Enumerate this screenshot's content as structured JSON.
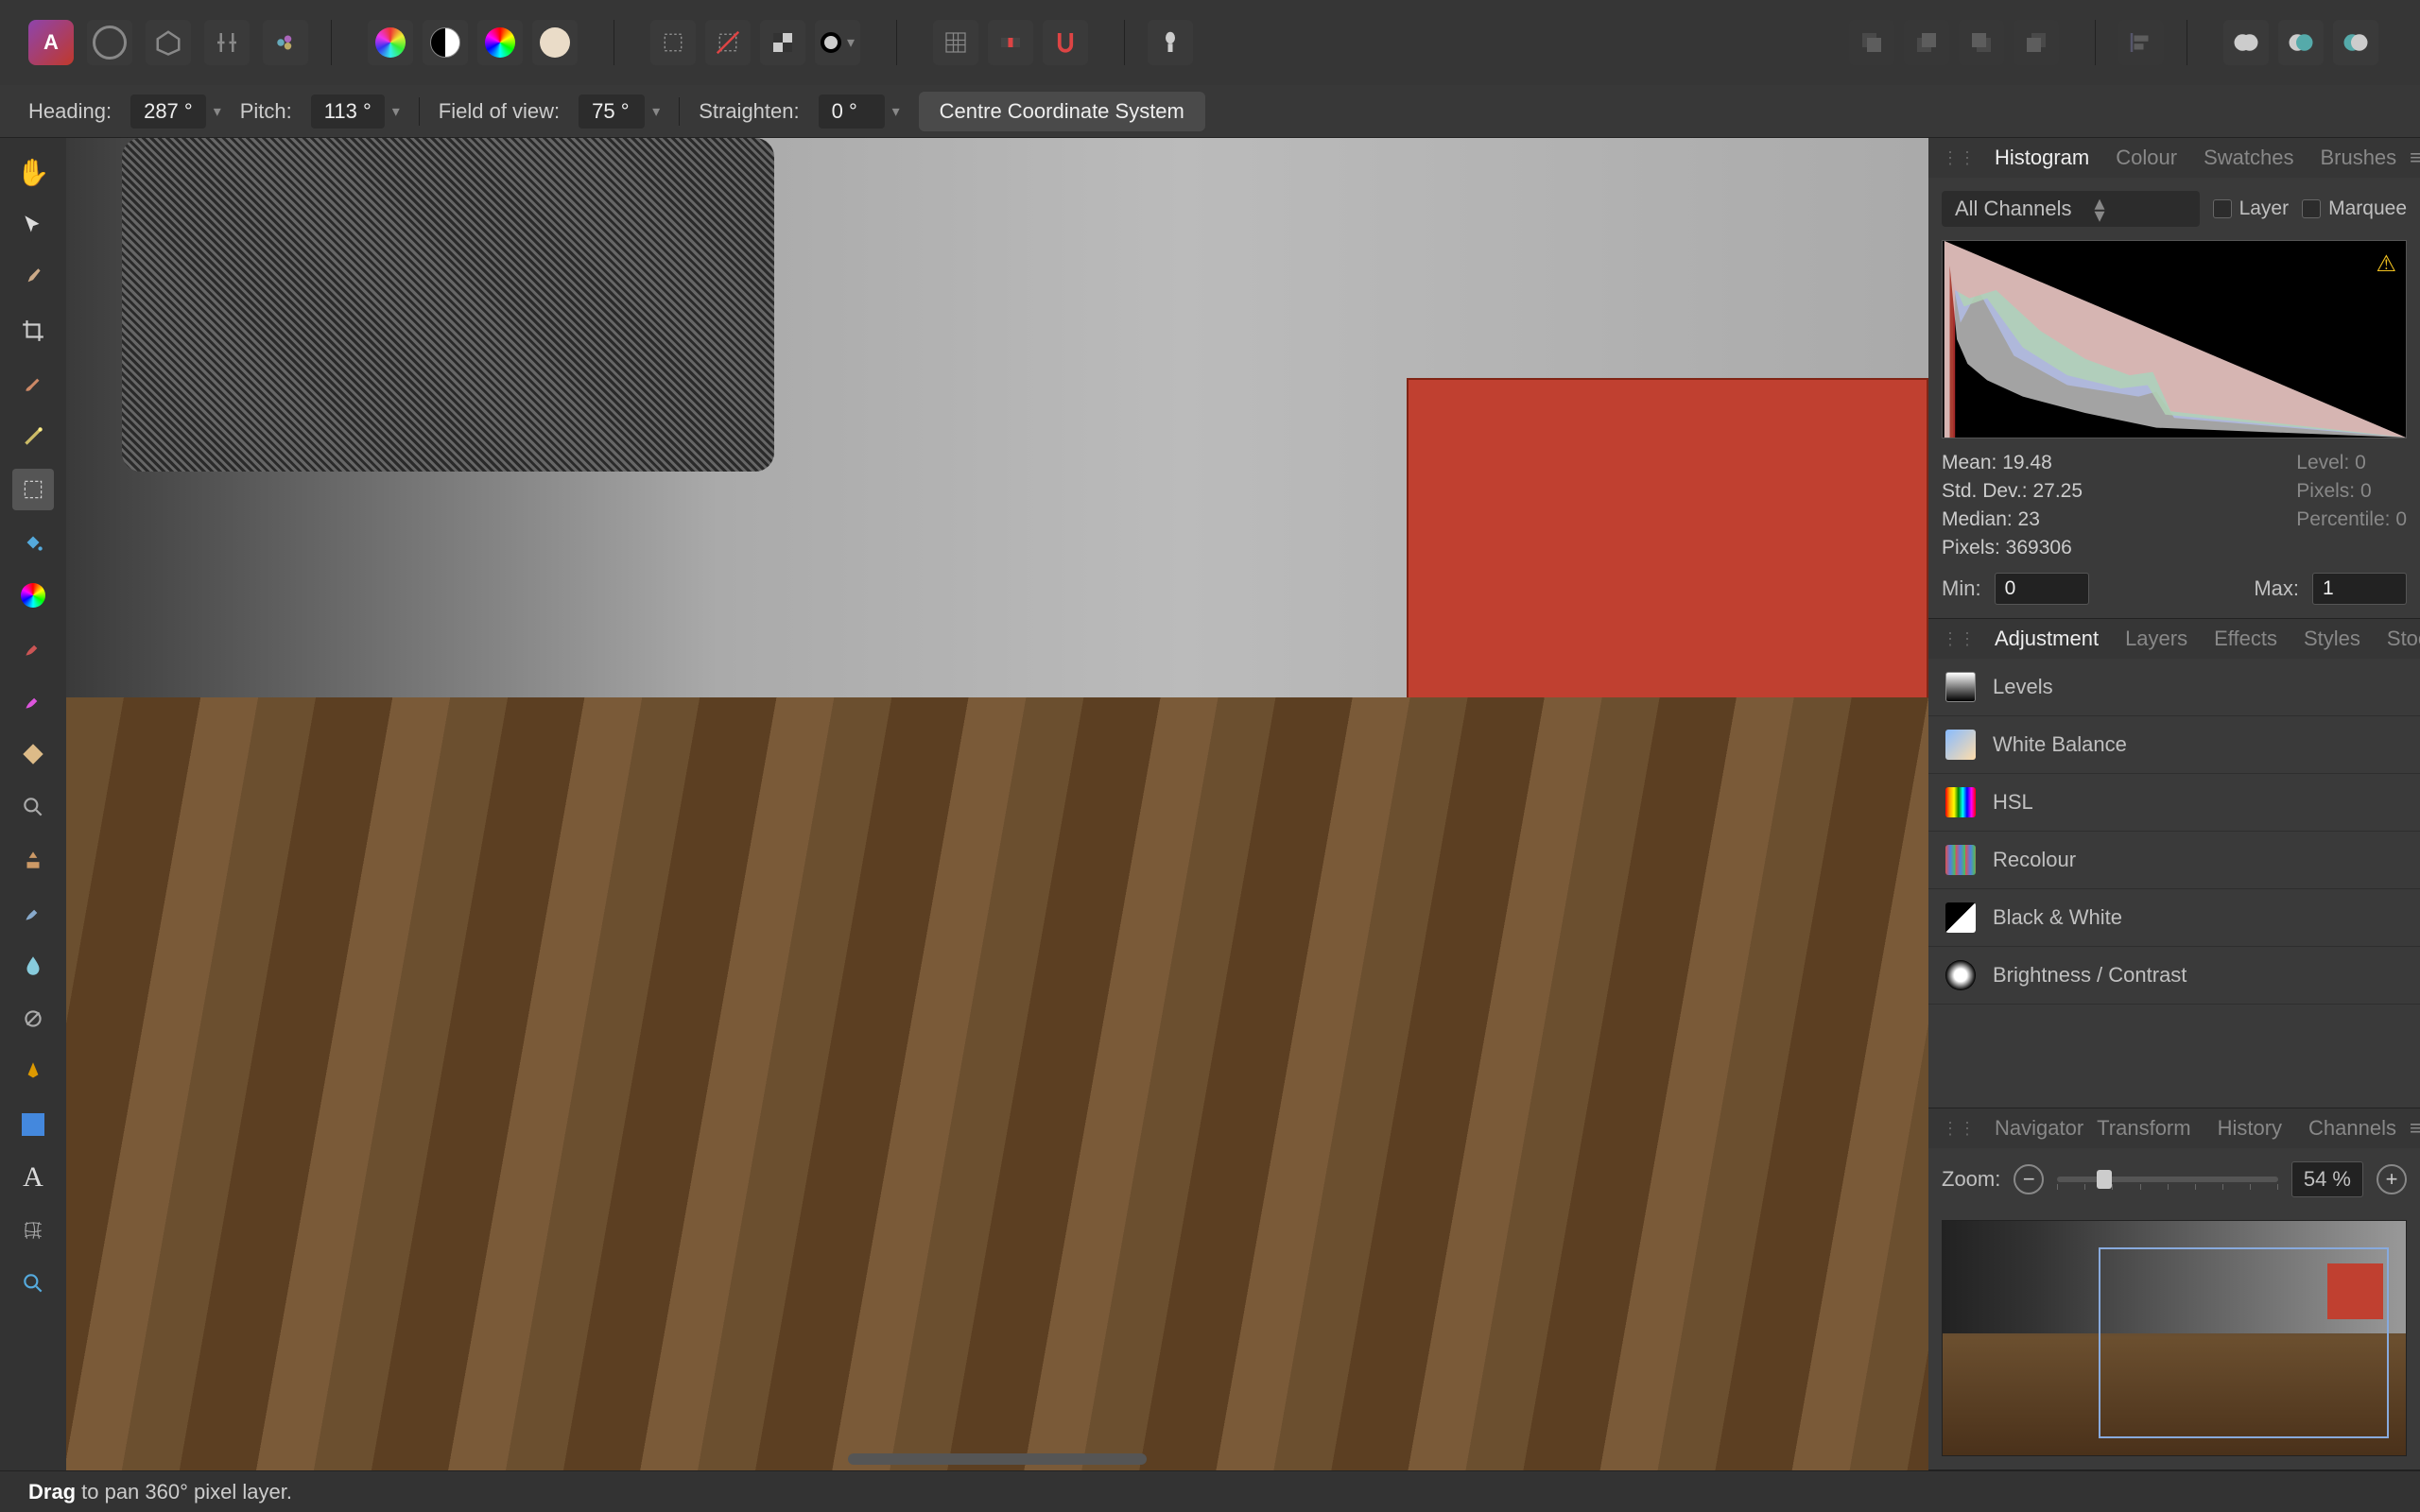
{
  "toolbar": {
    "app_icon_letter": "A"
  },
  "context_bar": {
    "heading_label": "Heading:",
    "heading_value": "287 °",
    "pitch_label": "Pitch:",
    "pitch_value": "113 °",
    "fov_label": "Field of view:",
    "fov_value": "75 °",
    "straighten_label": "Straighten:",
    "straighten_value": "0 °",
    "centre_button": "Centre Coordinate System"
  },
  "panels": {
    "histogram": {
      "tab_histogram": "Histogram",
      "tab_colour": "Colour",
      "tab_swatches": "Swatches",
      "tab_brushes": "Brushes",
      "channel_select": "All Channels",
      "layer_checkbox": "Layer",
      "marquee_checkbox": "Marquee",
      "stats": {
        "mean": "Mean: 19.48",
        "stddev": "Std. Dev.: 27.25",
        "median": "Median: 23",
        "pixels": "Pixels: 369306",
        "level": "Level: 0",
        "pixels2": "Pixels: 0",
        "percentile": "Percentile: 0"
      },
      "min_label": "Min:",
      "min_value": "0",
      "max_label": "Max:",
      "max_value": "1"
    },
    "adjustment": {
      "tab_adjustment": "Adjustment",
      "tab_layers": "Layers",
      "tab_effects": "Effects",
      "tab_styles": "Styles",
      "tab_stock": "Stock",
      "items": [
        "Levels",
        "White Balance",
        "HSL",
        "Recolour",
        "Black & White",
        "Brightness / Contrast"
      ]
    },
    "navigator": {
      "tab_navigator": "Navigator",
      "tab_transform": "Transform",
      "tab_history": "History",
      "tab_channels": "Channels",
      "zoom_label": "Zoom:",
      "zoom_value": "54 %"
    }
  },
  "status": {
    "bold": "Drag",
    "text": "to pan 360° pixel layer."
  }
}
